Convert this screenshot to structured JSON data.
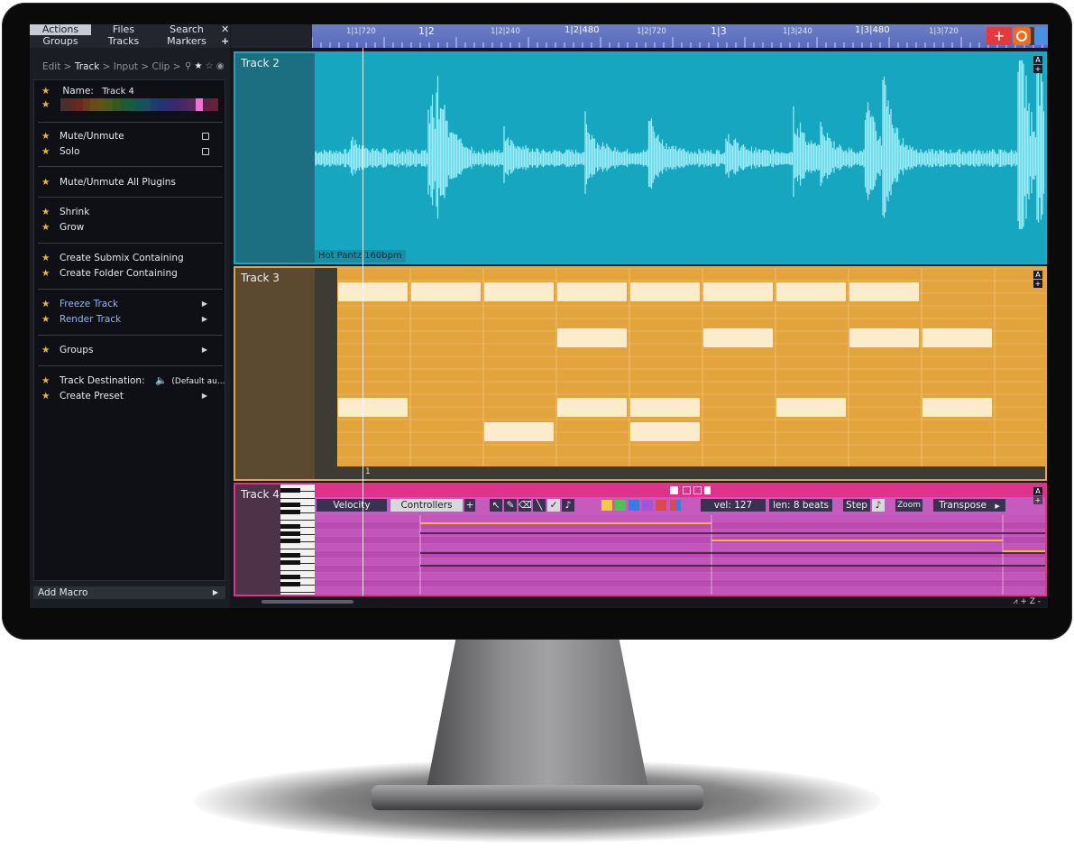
{
  "sidebar": {
    "top_tabs": [
      "Actions",
      "Files",
      "Search",
      "Groups",
      "Tracks",
      "Markers"
    ],
    "close_icon": "✕",
    "add_icon": "+",
    "breadcrumb": {
      "edit": "Edit",
      "track": "Track",
      "input": "Input",
      "clip": "Clip"
    },
    "name_label": "Name:",
    "name_value": "Track 4",
    "items": {
      "mute": "Mute/Unmute",
      "solo": "Solo",
      "mute_all_plugins": "Mute/Unmute All Plugins",
      "shrink": "Shrink",
      "grow": "Grow",
      "create_submix": "Create Submix Containing",
      "create_folder": "Create Folder Containing",
      "freeze": "Freeze Track",
      "render": "Render Track",
      "groups": "Groups",
      "destination_label": "Track Destination:",
      "destination_value": "(Default au...",
      "create_preset": "Create Preset"
    },
    "add_macro": "Add Macro",
    "colors": [
      "#4a2f2f",
      "#5a2a24",
      "#6a2a1f",
      "#6a3a1a",
      "#6a4a18",
      "#5e5418",
      "#4a5a1c",
      "#345a22",
      "#1f5a30",
      "#185a42",
      "#165454",
      "#1a4c62",
      "#1c3f6c",
      "#243472",
      "#302c72",
      "#3c286c",
      "#4a2866",
      "#58285e",
      "#f070d8",
      "#5a2244",
      "#682238"
    ]
  },
  "ruler": {
    "labels": [
      "1|1|720",
      "1|2",
      "1|2|240",
      "1|2|480",
      "1|2|720",
      "1|3",
      "1|3|240",
      "1|3|480",
      "1|3|720"
    ],
    "add_button": "+",
    "plus_button": "+"
  },
  "tracks": {
    "track2": {
      "name": "Track 2",
      "clip_label": "Hot Pantz 160bpm",
      "color": "#1aa7c0"
    },
    "track3": {
      "name": "Track 3",
      "bar_number": "1",
      "color": "#e0a640"
    },
    "track4": {
      "name": "Track 4",
      "color": "#c558be"
    }
  },
  "track_buttons": {
    "auto": "A",
    "add": "+"
  },
  "piano_roll": {
    "velocity": "Velocity",
    "controllers": "Controllers",
    "plus": "+",
    "vel": "vel: 127",
    "len": "len: 8 beats",
    "step": "Step",
    "zoom": "Zoom",
    "transpose": "Transpose",
    "swatches": [
      "#f5c842",
      "#4ec24e",
      "#3a7ce0",
      "#a255d8",
      "#e04848"
    ]
  },
  "bottom": {
    "zoom_controls": "+ Z -"
  }
}
